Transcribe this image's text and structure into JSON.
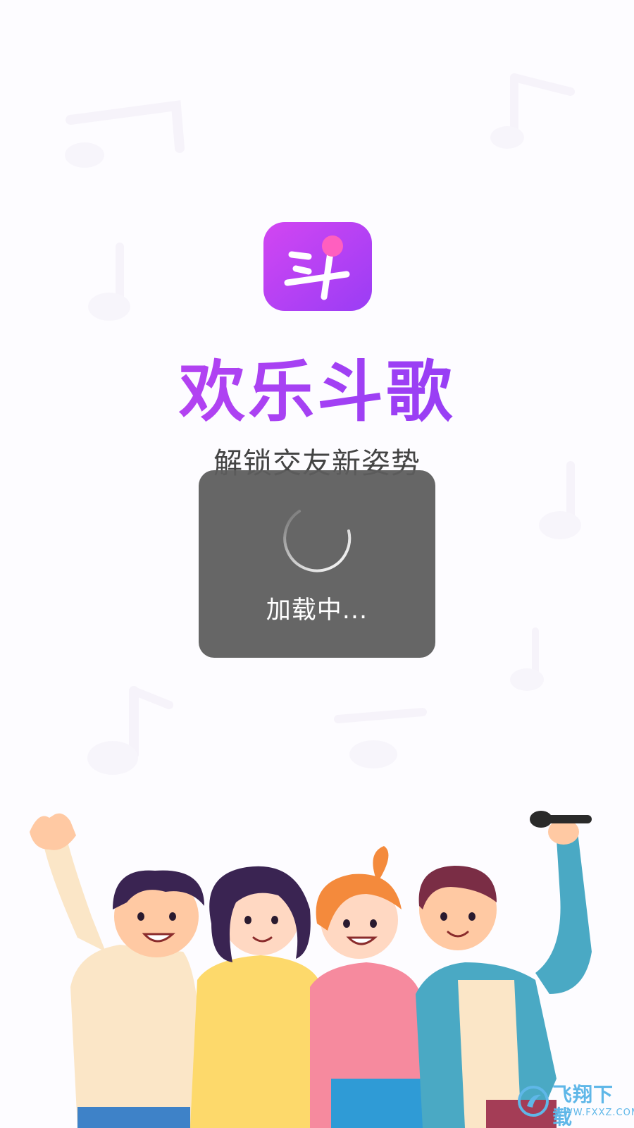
{
  "app": {
    "name": "欢乐斗歌",
    "slogan": "解锁交友新姿势"
  },
  "loading": {
    "text": "加载中..."
  },
  "icons": {
    "app_icon": "app-logo-icon",
    "spinner": "loading-spinner-icon",
    "background": "music-note-icon",
    "microphone": "microphone-icon"
  },
  "watermark": {
    "main": "飞翔下载",
    "sub": "WWW.FXXZ.COM"
  },
  "colors": {
    "brand_purple": "#a040f4",
    "brand_pink": "#ff66c4",
    "dialog_bg": "#5c5c5c",
    "watermark_blue": "#5fb7e8"
  }
}
